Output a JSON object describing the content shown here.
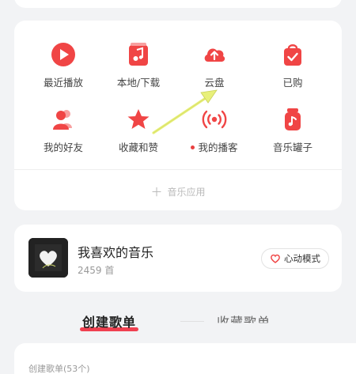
{
  "grid": {
    "items": [
      {
        "label": "最近播放",
        "icon": "play-circle-icon"
      },
      {
        "label": "本地/下载",
        "icon": "music-note-icon"
      },
      {
        "label": "云盘",
        "icon": "cloud-upload-icon"
      },
      {
        "label": "已购",
        "icon": "shopping-bag-icon"
      },
      {
        "label": "我的好友",
        "icon": "friends-icon"
      },
      {
        "label": "收藏和赞",
        "icon": "star-icon"
      },
      {
        "label": "我的播客",
        "icon": "broadcast-icon"
      },
      {
        "label": "音乐罐子",
        "icon": "music-jar-icon"
      }
    ],
    "app_label": "音乐应用"
  },
  "favorites": {
    "title": "我喜欢的音乐",
    "count": "2459 首",
    "mode_button": "心动模式"
  },
  "tabs": {
    "created": "创建歌单",
    "collected": "收藏歌单"
  },
  "list": {
    "title": "创建歌单(53个)"
  },
  "colors": {
    "accent": "#f04050",
    "annotation_arrow": "#e8f07a"
  }
}
